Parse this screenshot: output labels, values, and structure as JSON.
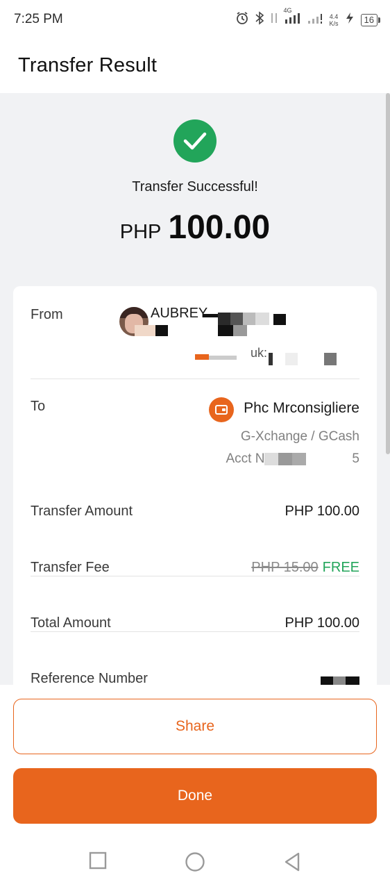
{
  "status_bar": {
    "time": "7:25 PM",
    "network": "4G",
    "speed_value": "4.4",
    "speed_unit": "K/s",
    "battery": "16"
  },
  "header": {
    "title": "Transfer Result"
  },
  "result": {
    "message": "Transfer Successful!",
    "currency": "PHP",
    "amount": "100.00",
    "icon": "check-circle-icon",
    "icon_color": "#22a55a"
  },
  "details": {
    "from": {
      "label": "From",
      "name": "AUBREY",
      "sub": "uk:"
    },
    "to": {
      "label": "To",
      "name": "Phc Mrconsigliere",
      "bank": "G-Xchange / GCash",
      "account_prefix": "Acct N",
      "account_suffix": "5"
    },
    "transfer_amount": {
      "label": "Transfer Amount",
      "value": "PHP 100.00"
    },
    "transfer_fee": {
      "label": "Transfer Fee",
      "old_value": "PHP 15.00",
      "value": "FREE"
    },
    "total_amount": {
      "label": "Total Amount",
      "value": "PHP 100.00"
    },
    "reference": {
      "label": "Reference Number"
    }
  },
  "actions": {
    "share_label": "Share",
    "done_label": "Done"
  },
  "colors": {
    "accent": "#e8651d",
    "success": "#22a55a",
    "background": "#f1f2f4"
  },
  "nav": {
    "recent": "square-icon",
    "home": "circle-icon",
    "back": "triangle-back-icon"
  }
}
